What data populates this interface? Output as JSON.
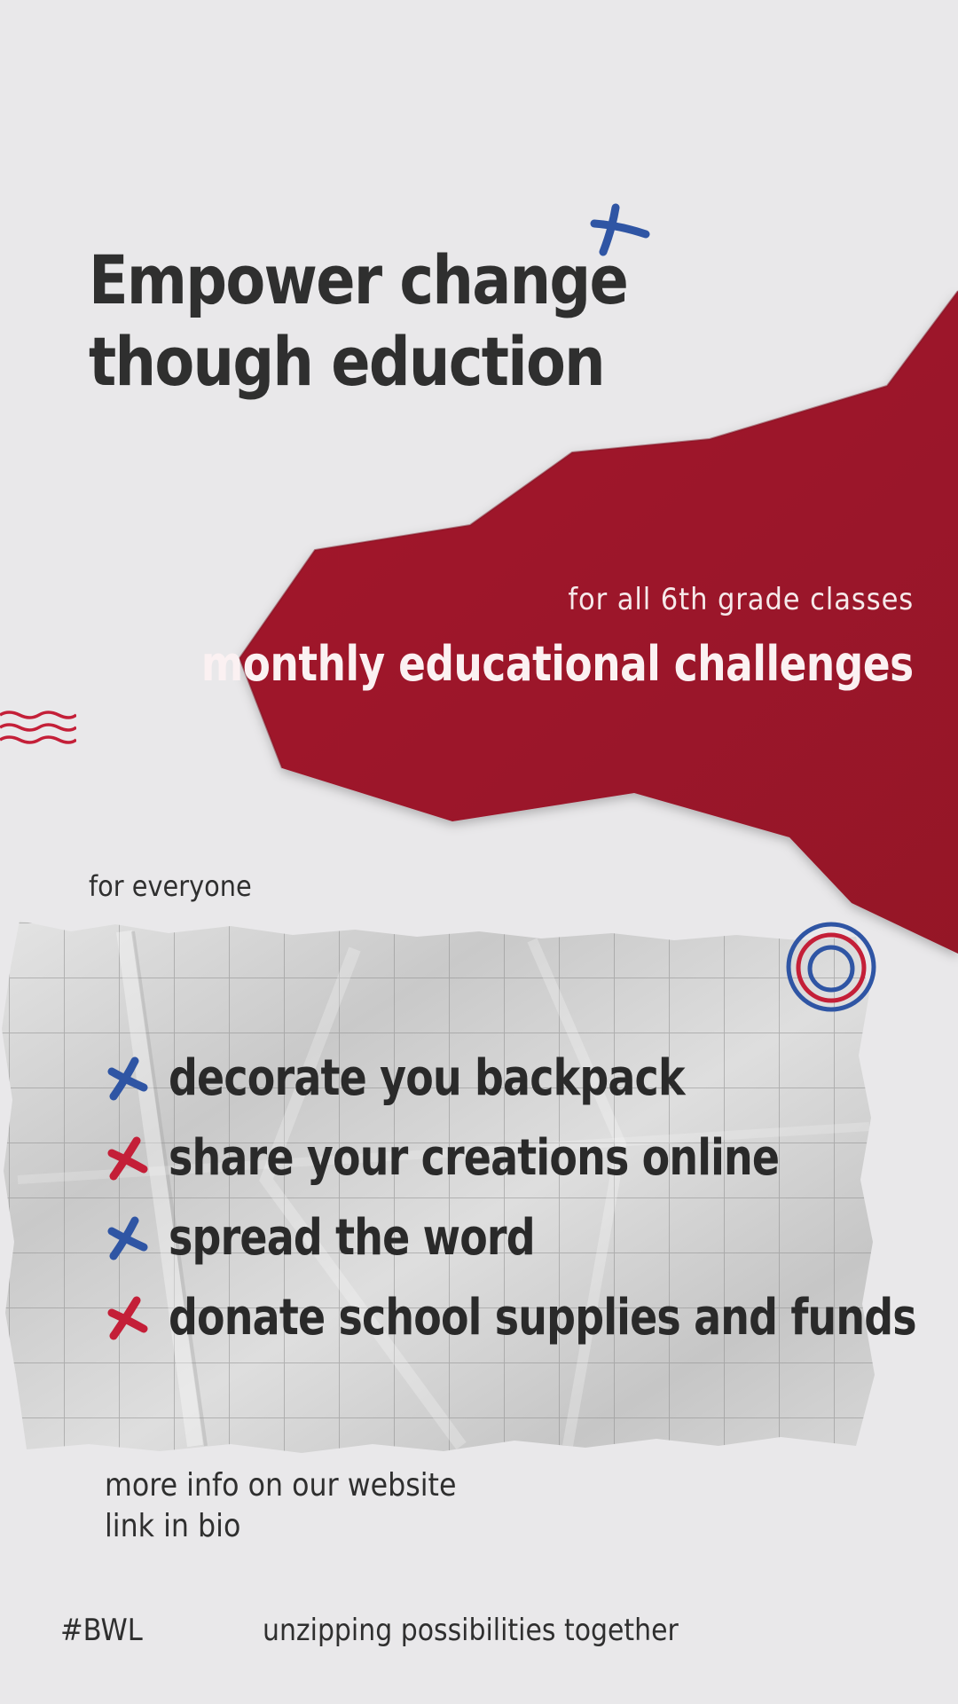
{
  "title": {
    "line1": "Empower change",
    "line2": "though eduction"
  },
  "banner": {
    "subtitle": "for all 6th grade classes",
    "headline": "monthly educational challenges"
  },
  "audience_label": "for everyone",
  "challenges": [
    {
      "text": "decorate you backpack",
      "icon": "x-mark-icon",
      "color": "#2f55a4"
    },
    {
      "text": "share your creations online",
      "icon": "x-mark-icon",
      "color": "#c41f38"
    },
    {
      "text": "spread the word",
      "icon": "x-mark-icon",
      "color": "#2f55a4"
    },
    {
      "text": "donate school supplies and funds",
      "icon": "x-mark-icon",
      "color": "#c41f38"
    }
  ],
  "info": {
    "line1": "more info on our website",
    "line2": "link in bio"
  },
  "footer": {
    "hashtag": "#BWL",
    "tagline": "unzipping possibilities together"
  },
  "colors": {
    "background": "#e9e8ea",
    "red": "#a0162a",
    "blue": "#2f55a4",
    "accent_red": "#c41f38",
    "text": "#2f2f2f"
  }
}
